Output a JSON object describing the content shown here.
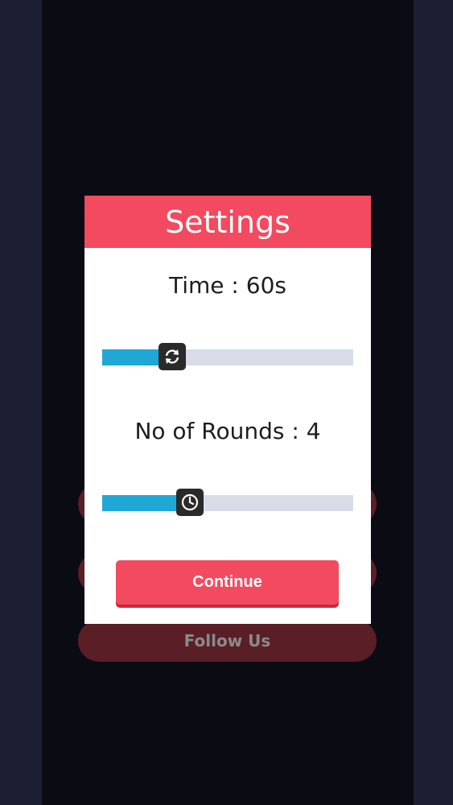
{
  "background_menu": {
    "follow_label": "Follow Us"
  },
  "modal": {
    "title": "Settings",
    "time_label": "Time : 60s",
    "rounds_label": "No of Rounds : 4",
    "continue_label": "Continue",
    "time_slider": {
      "fraction": 0.28,
      "icon": "refresh-icon"
    },
    "rounds_slider": {
      "fraction": 0.35,
      "icon": "clock-icon"
    }
  },
  "colors": {
    "accent": "#f24a5f",
    "slider_fill": "#1fa8d6",
    "slider_track": "#d9dce8",
    "background": "#0b0b13"
  }
}
